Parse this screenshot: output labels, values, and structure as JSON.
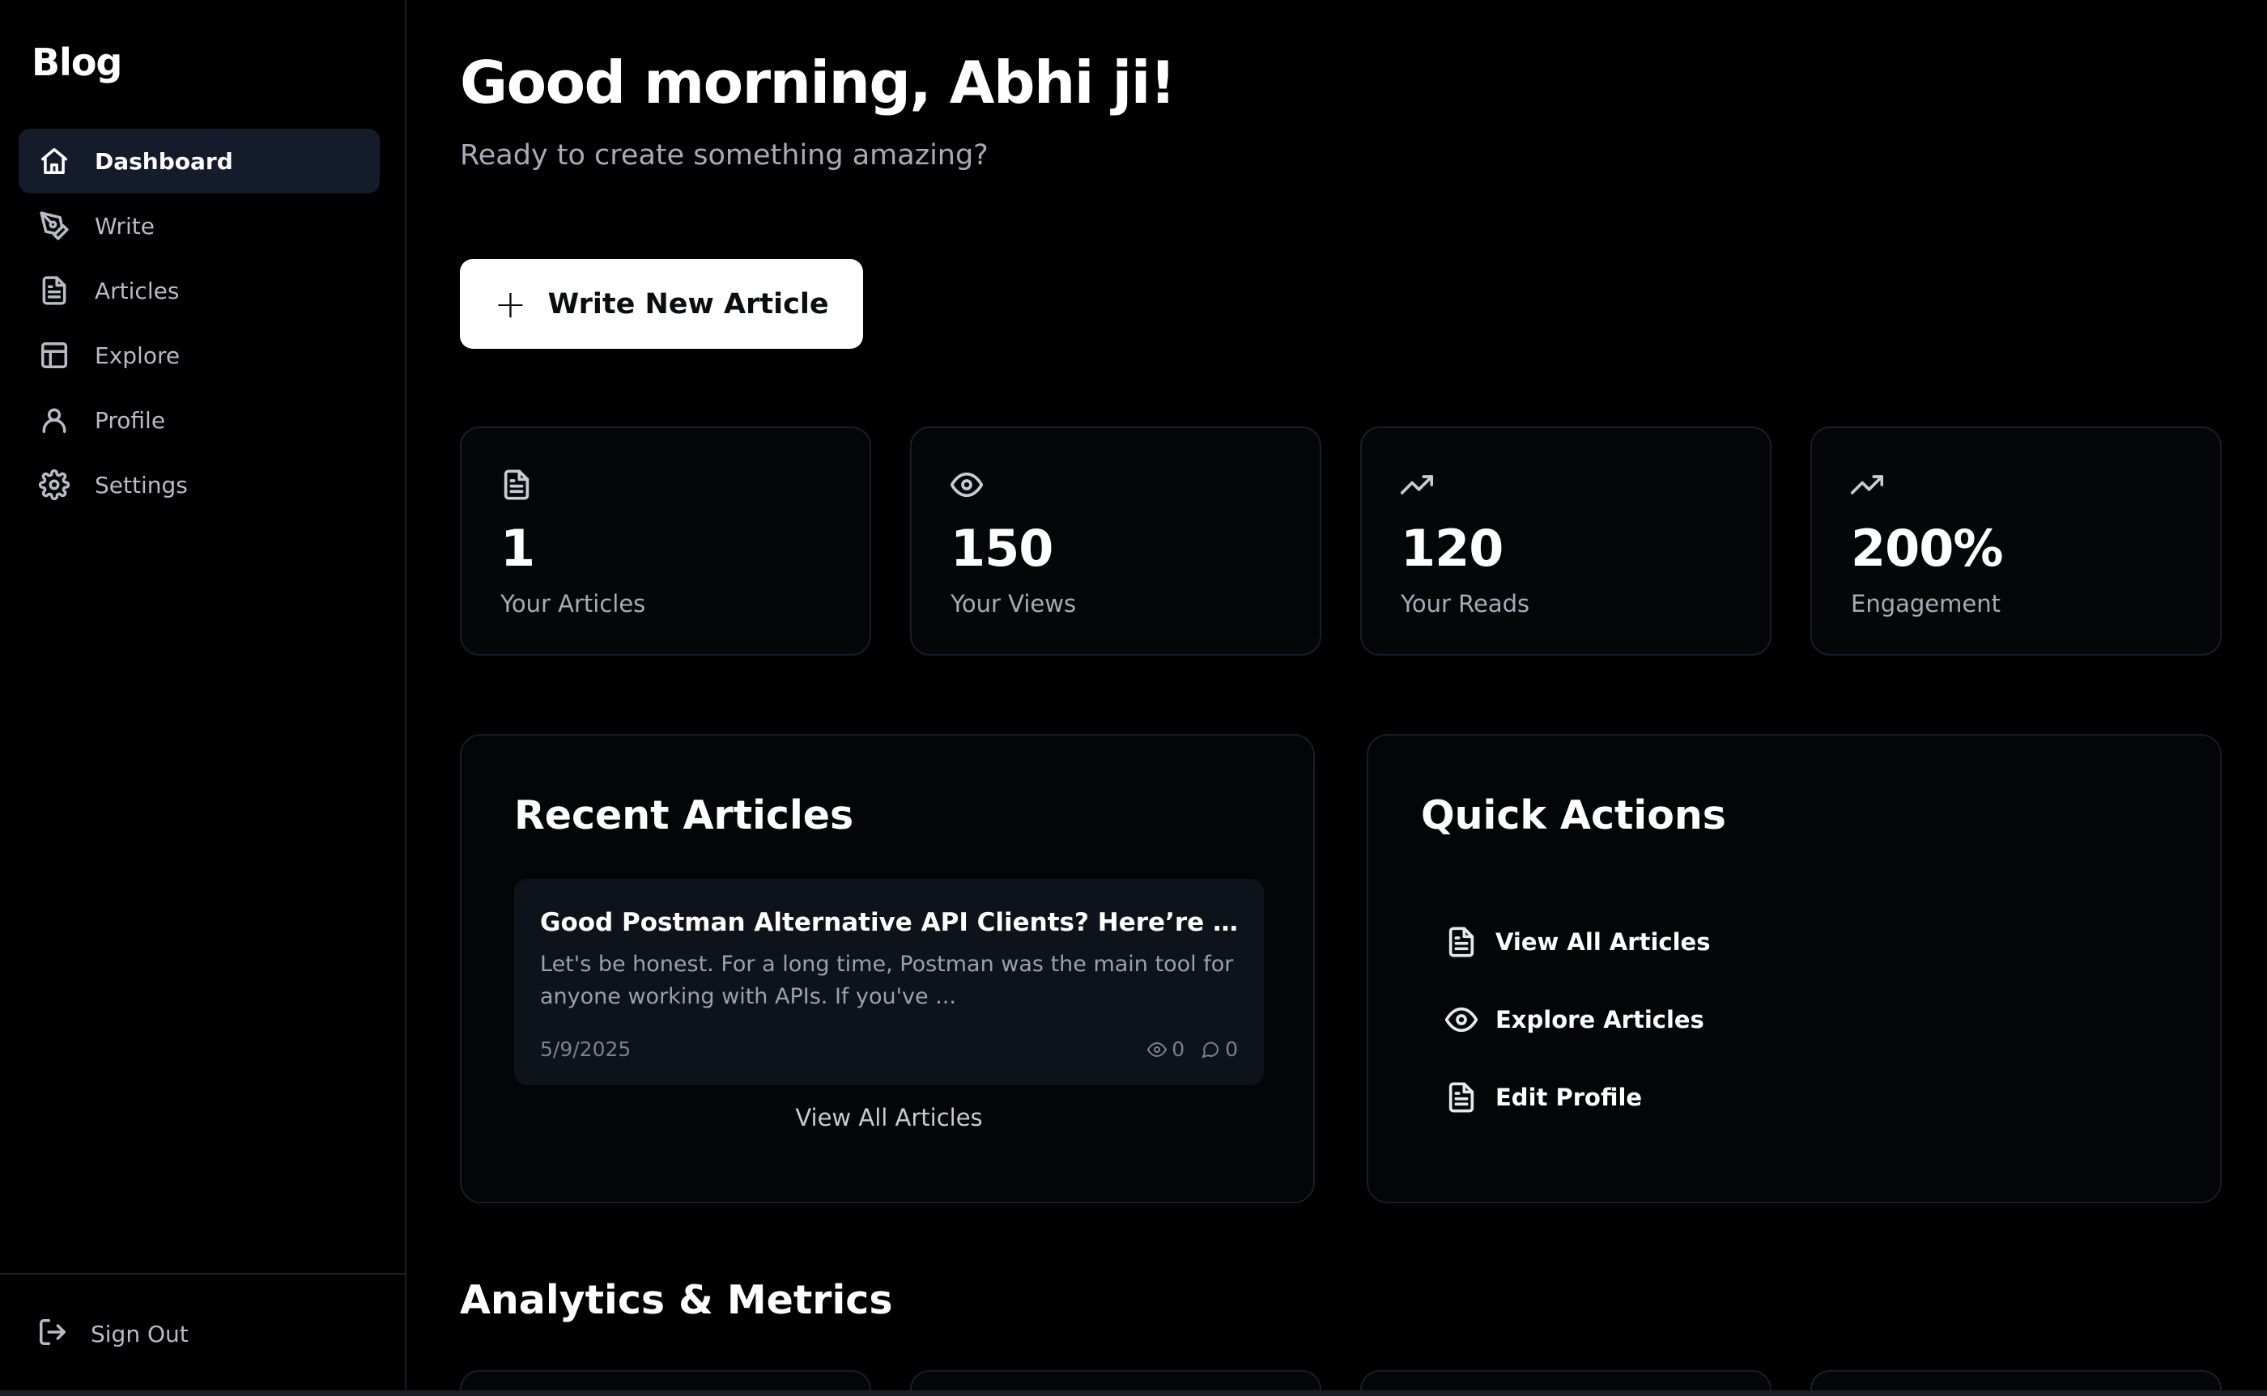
{
  "sidebar": {
    "brand": "Blog",
    "items": [
      {
        "label": "Dashboard",
        "icon": "home-icon",
        "active": true
      },
      {
        "label": "Write",
        "icon": "pen-tool-icon"
      },
      {
        "label": "Articles",
        "icon": "file-text-icon"
      },
      {
        "label": "Explore",
        "icon": "layout-icon"
      },
      {
        "label": "Profile",
        "icon": "user-icon"
      },
      {
        "label": "Settings",
        "icon": "gear-icon"
      }
    ],
    "sign_out": "Sign Out"
  },
  "header": {
    "greeting": "Good morning, Abhi ji!",
    "subtitle": "Ready to create something amazing?"
  },
  "write_button": {
    "plus": "+",
    "label": "Write New Article"
  },
  "stats": [
    {
      "value": "1",
      "caption": "Your Articles",
      "icon": "file-text-icon"
    },
    {
      "value": "150",
      "caption": "Your Views",
      "icon": "eye-icon"
    },
    {
      "value": "120",
      "caption": "Your Reads",
      "icon": "trending-up-icon"
    },
    {
      "value": "200%",
      "caption": "Engagement",
      "icon": "trending-up-icon"
    }
  ],
  "recent_articles": {
    "title": "Recent Articles",
    "items": [
      {
        "title": "Good Postman Alternative API Clients? Here’re My Top Picks",
        "excerpt": "Let's be honest. For a long time, Postman was the main tool for anyone working with APIs. If you've ...",
        "date": "5/9/2025",
        "views": "0",
        "comments": "0"
      }
    ],
    "view_all": "View All Articles"
  },
  "quick_actions": {
    "title": "Quick Actions",
    "items": [
      {
        "label": "View All Articles",
        "icon": "file-text-icon"
      },
      {
        "label": "Explore Articles",
        "icon": "eye-icon"
      },
      {
        "label": "Edit Profile",
        "icon": "file-text-icon"
      }
    ]
  },
  "analytics": {
    "title": "Analytics & Metrics"
  }
}
